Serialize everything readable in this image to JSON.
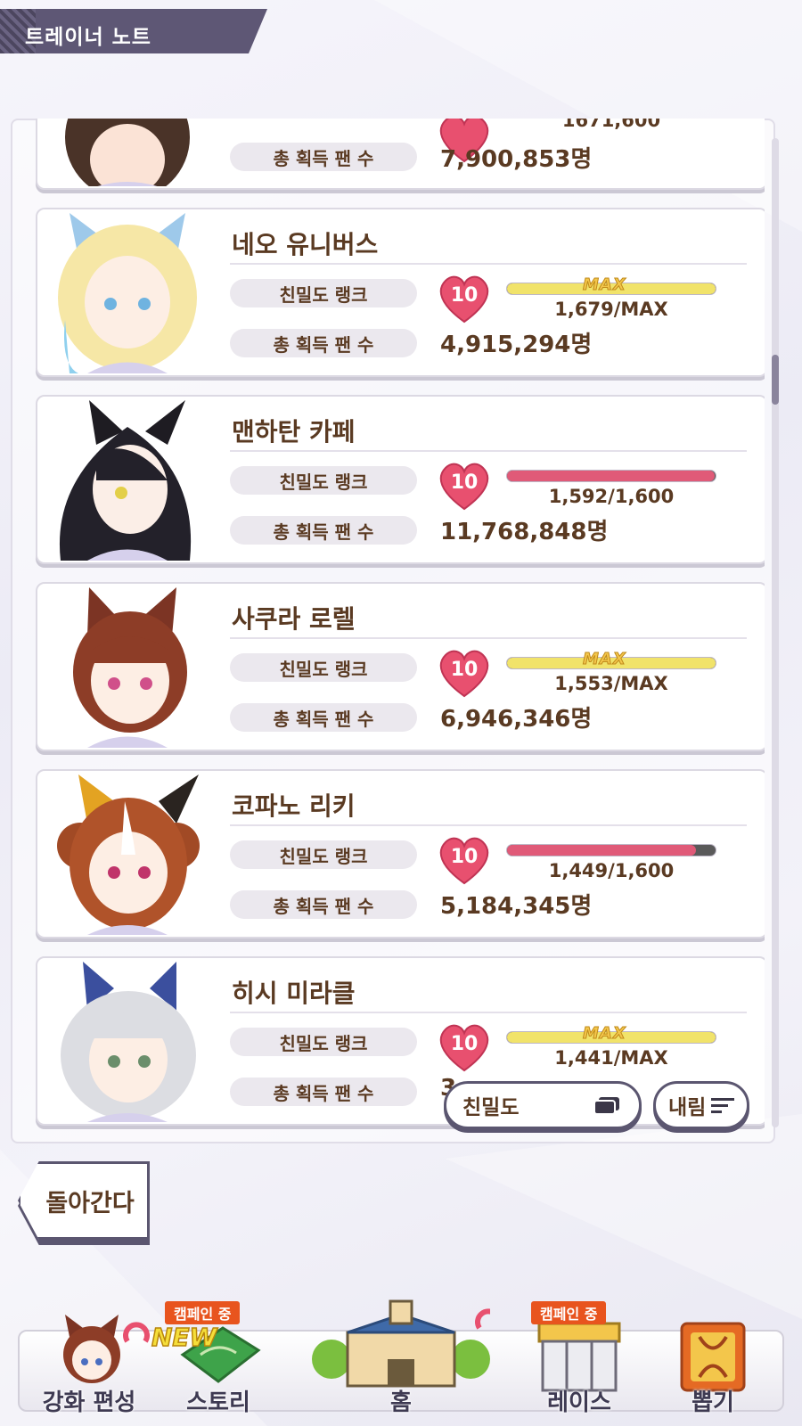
{
  "header": {
    "title": "트레이너 노트"
  },
  "labels": {
    "affinity": "친밀도 랭크",
    "fans": "총 획득 팬 수"
  },
  "top_partial": {
    "progress": "1671,600",
    "fans": "7,900,853명"
  },
  "characters": [
    {
      "name": "네오 유니버스",
      "rank": "10",
      "max": true,
      "max_label": "MAX",
      "progress": "1,679/MAX",
      "progress_fraction": 1.0,
      "fans": "4,915,294명"
    },
    {
      "name": "맨하탄 카페",
      "rank": "10",
      "max": false,
      "progress": "1,592/1,600",
      "progress_fraction": 0.995,
      "fans": "11,768,848명"
    },
    {
      "name": "사쿠라 로렐",
      "rank": "10",
      "max": true,
      "max_label": "MAX",
      "progress": "1,553/MAX",
      "progress_fraction": 1.0,
      "fans": "6,946,346명"
    },
    {
      "name": "코파노 리키",
      "rank": "10",
      "max": false,
      "progress": "1,449/1,600",
      "progress_fraction": 0.905,
      "fans": "5,184,345명"
    },
    {
      "name": "히시 미라클",
      "rank": "10",
      "max": true,
      "max_label": "MAX",
      "progress": "1,441/MAX",
      "progress_fraction": 1.0,
      "fans": "3"
    }
  ],
  "sort": {
    "key_label": "친밀도",
    "order_label": "내림"
  },
  "back_label": "돌아간다",
  "nav": {
    "campaign": "캠페인 중",
    "new": "NEW",
    "items": [
      "강화 편성",
      "스토리",
      "홈",
      "레이스",
      "뽑기"
    ]
  },
  "colors": {
    "heart": "#e8506f",
    "bar_max": "#f1e36a",
    "bar_progress": "#e05a78",
    "frame": "#5b5670"
  }
}
